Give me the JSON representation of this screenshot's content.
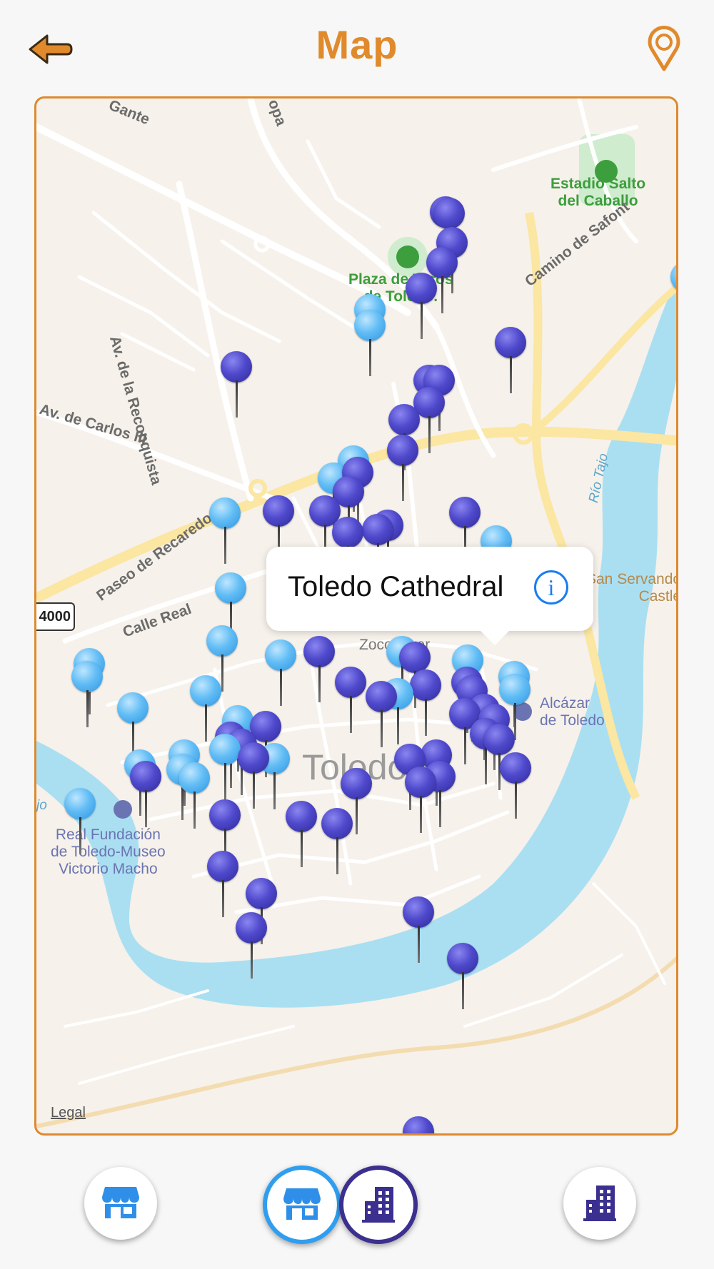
{
  "header": {
    "title": "Map",
    "back_icon": "arrow-left-icon",
    "locate_icon": "map-pin-icon",
    "accent_color": "#e08a2c"
  },
  "map": {
    "labels": {
      "gante": "Gante",
      "opa": "opa",
      "estadio": "Estadio Salto\ndel Caballo",
      "plaza": "Plaza de Toros\nde Toledo.",
      "camino": "Camino de Safont",
      "reconquista": "Av. de la Reconquista",
      "carlos": "Av. de Carlos III",
      "rio_tajo": "Río Tajo",
      "recaredo": "Paseo de Recaredo",
      "calle_real": "Calle Real",
      "route": "4000",
      "san_servando": "San Servando\nCastle",
      "alcazar": "Alcázar\nde Toledo",
      "toledo": "Toledo",
      "tajo_left": "jo",
      "fundacion": "Real Fundación\nde Toledo-Museo\nVictorio Macho",
      "zocodover": "Zocodover",
      "legal": "Legal"
    },
    "pin_colors": {
      "dark": "#4f49cc",
      "light": "#62bdf5"
    },
    "callout": {
      "title": "Toledo Cathedral",
      "info_icon": "info-icon"
    }
  },
  "bottom_bar": {
    "buttons": [
      {
        "name": "shops-filter",
        "icon": "store-icon",
        "selected": false
      },
      {
        "name": "shops-filter-active",
        "icon": "store-icon",
        "selected": true
      },
      {
        "name": "buildings-filter-active",
        "icon": "building-icon",
        "selected": true
      },
      {
        "name": "buildings-filter",
        "icon": "building-icon",
        "selected": false
      }
    ],
    "shop_color": "#2f8fe8",
    "building_color": "#3b2f8f"
  }
}
